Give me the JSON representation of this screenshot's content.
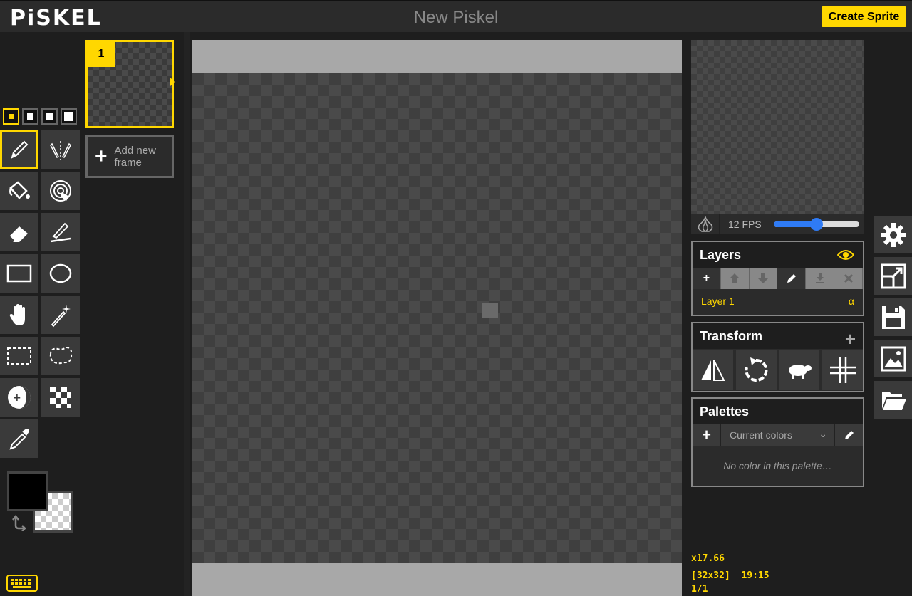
{
  "app": {
    "logo": "PiSKEL",
    "title": "New Piskel",
    "create_button": "Create Sprite"
  },
  "pen_sizes": [
    "1",
    "2",
    "3",
    "4"
  ],
  "tools": [
    {
      "name": "pen-tool",
      "icon": "pencil-icon"
    },
    {
      "name": "vertical-mirror-pen-tool",
      "icon": "mirror-pen-icon"
    },
    {
      "name": "paint-bucket-tool",
      "icon": "bucket-icon"
    },
    {
      "name": "paint-all-same-color-tool",
      "icon": "target-bucket-icon"
    },
    {
      "name": "eraser-tool",
      "icon": "eraser-icon"
    },
    {
      "name": "stroke-tool",
      "icon": "line-icon"
    },
    {
      "name": "rectangle-tool",
      "icon": "rectangle-icon"
    },
    {
      "name": "circle-tool",
      "icon": "circle-icon"
    },
    {
      "name": "move-tool",
      "icon": "hand-icon"
    },
    {
      "name": "shape-selection-tool",
      "icon": "magic-wand-icon"
    },
    {
      "name": "rectangle-selection-tool",
      "icon": "dashed-rect-icon"
    },
    {
      "name": "lasso-selection-tool",
      "icon": "lasso-icon"
    },
    {
      "name": "lighten-tool",
      "icon": "lighten-icon"
    },
    {
      "name": "dithering-tool",
      "icon": "checker-icon"
    },
    {
      "name": "color-picker-tool",
      "icon": "eyedropper-icon"
    }
  ],
  "colors": {
    "primary": "#000000",
    "secondary": "transparent",
    "accent": "#ffd700"
  },
  "frames": {
    "items": [
      {
        "number": "1"
      }
    ],
    "add_label": "Add new frame"
  },
  "preview": {
    "fps_label": "12 FPS",
    "fps_fraction": 0.5
  },
  "layers": {
    "title": "Layers",
    "items": [
      {
        "name": "Layer 1",
        "opacity_symbol": "α"
      }
    ]
  },
  "transform": {
    "title": "Transform"
  },
  "palettes": {
    "title": "Palettes",
    "selected": "Current colors",
    "empty_message": "No color in this palette…"
  },
  "status": {
    "zoom": "x17.66",
    "size_and_cursor": "[32x32]  19:15",
    "frame_index": "1/1"
  }
}
